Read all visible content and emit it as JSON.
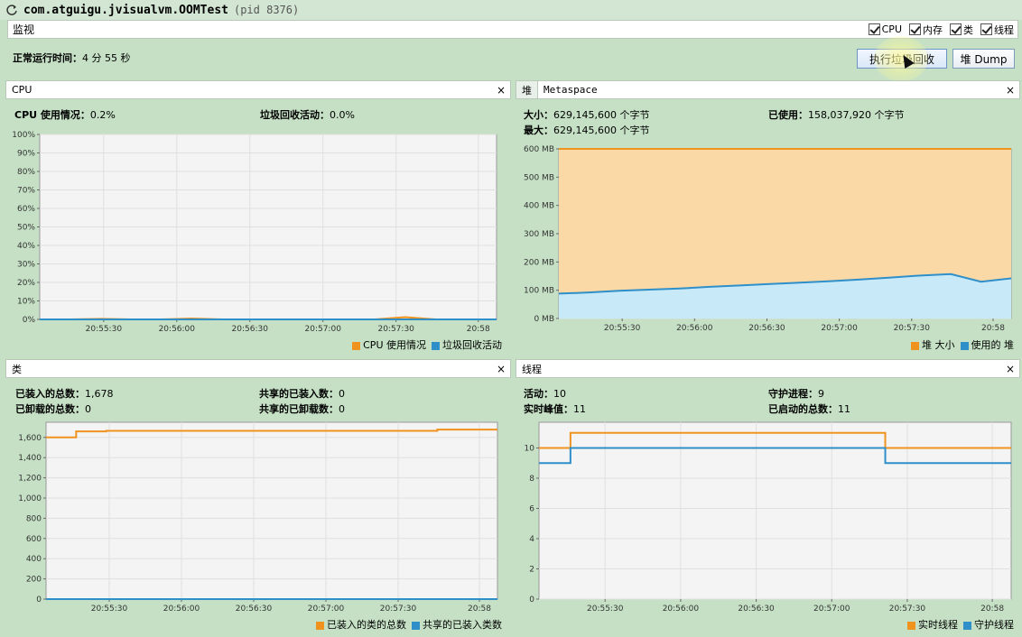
{
  "window": {
    "title": "com.atguigu.jvisualvm.OOMTest",
    "pid": "(pid 8376)"
  },
  "tabstrip": {
    "label": "监视",
    "checks": [
      {
        "label": "CPU",
        "checked": true
      },
      {
        "label": "内存",
        "checked": true
      },
      {
        "label": "类",
        "checked": true
      },
      {
        "label": "线程",
        "checked": true
      }
    ]
  },
  "uptime": {
    "label": "正常运行时间：",
    "value": "4 分 55 秒"
  },
  "buttons": {
    "gc": "执行垃圾回收",
    "dump": "堆 Dump"
  },
  "colors": {
    "orange": "#f0931e",
    "blue": "#2f8fc9",
    "orange_fill": "#fbd9a6",
    "blue_fill": "#c8e9f7"
  },
  "cpu": {
    "tab": "CPU",
    "usage_label": "CPU 使用情况：",
    "usage_value": "0.2%",
    "gc_label": "垃圾回收活动：",
    "gc_value": "0.0%",
    "legend": [
      "CPU 使用情况",
      "垃圾回收活动"
    ]
  },
  "heap": {
    "tab_active": "堆",
    "tab_other": "Metaspace",
    "size_label": "大小：",
    "size_value": "629,145,600 个字节",
    "max_label": "最大：",
    "max_value": "629,145,600 个字节",
    "used_label": "已使用：",
    "used_value": "158,037,920 个字节",
    "legend": [
      "堆 大小",
      "使用的 堆"
    ]
  },
  "classes": {
    "tab": "类",
    "loaded_label": "已装入的总数：",
    "loaded_value": "1,678",
    "unloaded_label": "已卸载的总数：",
    "unloaded_value": "0",
    "shared_loaded_label": "共享的已装入数：",
    "shared_loaded_value": "0",
    "shared_unloaded_label": "共享的已卸载数：",
    "shared_unloaded_value": "0",
    "legend": [
      "已装入的类的总数",
      "共享的已装入类数"
    ]
  },
  "threads": {
    "tab": "线程",
    "live_label": "活动：",
    "live_value": "10",
    "peak_label": "实时峰值：",
    "peak_value": "11",
    "daemon_label": "守护进程：",
    "daemon_value": "9",
    "started_label": "已启动的总数：",
    "started_value": "11",
    "legend": [
      "实时线程",
      "守护线程"
    ]
  },
  "chart_data": [
    {
      "type": "line",
      "name": "CPU",
      "x_ticks": [
        "20:55:30",
        "20:56:00",
        "20:56:30",
        "20:57:00",
        "20:57:30",
        "20:58"
      ],
      "y_ticks": [
        "0%",
        "10%",
        "20%",
        "30%",
        "40%",
        "50%",
        "60%",
        "70%",
        "80%",
        "90%",
        "100%"
      ],
      "ylim": [
        0,
        100
      ],
      "series": [
        {
          "name": "CPU 使用情况",
          "values": [
            0,
            0,
            0.3,
            0,
            0,
            0.5,
            0,
            0,
            0,
            0,
            0,
            0,
            1.2,
            0,
            0,
            0
          ]
        },
        {
          "name": "垃圾回收活动",
          "values": [
            0,
            0,
            0,
            0,
            0,
            0,
            0,
            0,
            0,
            0,
            0,
            0,
            0,
            0,
            0,
            0
          ]
        }
      ]
    },
    {
      "type": "area",
      "name": "堆",
      "x_ticks": [
        "20:55:30",
        "20:56:00",
        "20:56:30",
        "20:57:00",
        "20:57:30",
        "20:58"
      ],
      "y_ticks": [
        "0 MB",
        "100 MB",
        "200 MB",
        "300 MB",
        "400 MB",
        "500 MB",
        "600 MB"
      ],
      "ylim": [
        0,
        600
      ],
      "series": [
        {
          "name": "堆 大小",
          "values": [
            600,
            600,
            600,
            600,
            600,
            600,
            600,
            600,
            600,
            600,
            600,
            600,
            600,
            600,
            600,
            600
          ]
        },
        {
          "name": "使用的 堆",
          "values": [
            88,
            92,
            98,
            102,
            106,
            112,
            117,
            122,
            127,
            132,
            138,
            145,
            152,
            157,
            130,
            142
          ]
        }
      ]
    },
    {
      "type": "line",
      "name": "类",
      "x_ticks": [
        "20:55:30",
        "20:56:00",
        "20:56:30",
        "20:57:00",
        "20:57:30",
        "20:58"
      ],
      "y_ticks": [
        "0",
        "200",
        "400",
        "600",
        "800",
        "1,000",
        "1,200",
        "1,400",
        "1,600"
      ],
      "ylim": [
        0,
        1750
      ],
      "series": [
        {
          "name": "已装入的类的总数",
          "values": [
            1600,
            1660,
            1665,
            1665,
            1665,
            1665,
            1665,
            1665,
            1665,
            1665,
            1665,
            1665,
            1665,
            1678,
            1678,
            1678
          ]
        },
        {
          "name": "共享的已装入类数",
          "values": [
            0,
            0,
            0,
            0,
            0,
            0,
            0,
            0,
            0,
            0,
            0,
            0,
            0,
            0,
            0,
            0
          ]
        }
      ]
    },
    {
      "type": "line",
      "name": "线程",
      "x_ticks": [
        "20:55:30",
        "20:56:00",
        "20:56:30",
        "20:57:00",
        "20:57:30",
        "20:58"
      ],
      "y_ticks": [
        "0",
        "2",
        "4",
        "6",
        "8",
        "10"
      ],
      "ylim": [
        0,
        11.7
      ],
      "series": [
        {
          "name": "实时线程",
          "values": [
            10,
            11,
            11,
            11,
            11,
            11,
            11,
            11,
            11,
            11,
            11,
            10,
            10,
            10,
            10,
            10
          ]
        },
        {
          "name": "守护线程",
          "values": [
            9,
            10,
            10,
            10,
            10,
            10,
            10,
            10,
            10,
            10,
            10,
            9,
            9,
            9,
            9,
            9
          ]
        }
      ]
    }
  ]
}
